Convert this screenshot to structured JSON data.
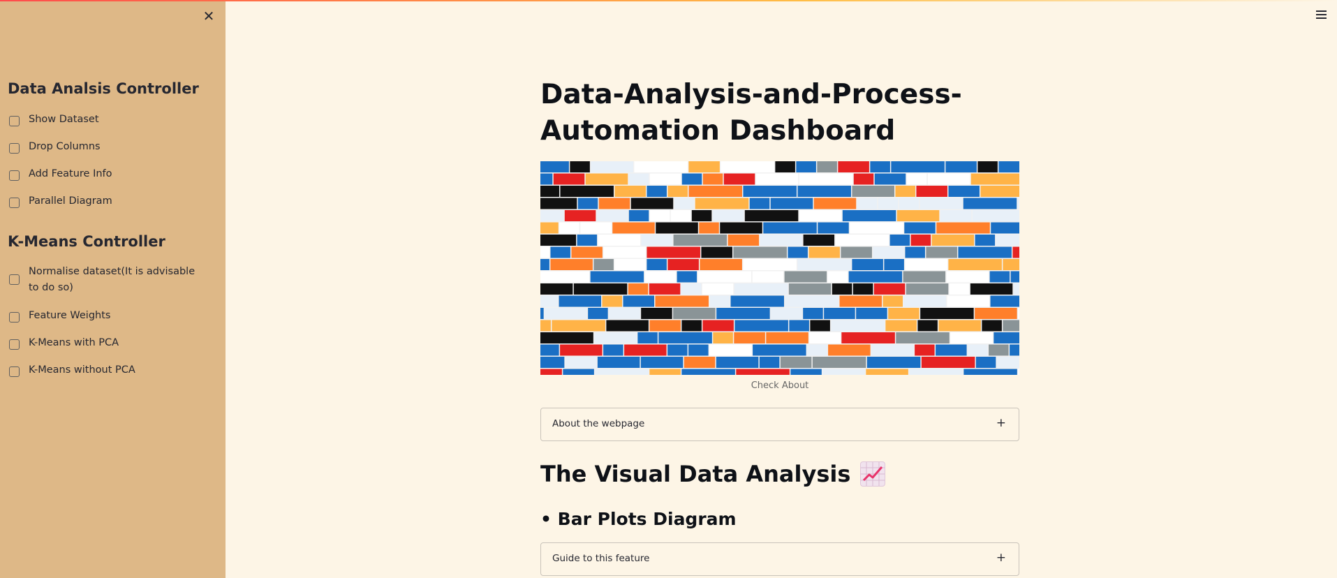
{
  "sidebar": {
    "close_icon": "close-icon",
    "sections": [
      {
        "title": "Data Analsis Controller",
        "items": [
          "Show Dataset",
          "Drop Columns",
          "Add Feature Info",
          "Parallel Diagram"
        ]
      },
      {
        "title": "K-Means Controller",
        "items": [
          "Normalise dataset(It is advisable to do so)",
          "Feature Weights",
          "K-Means with PCA",
          "K-Means without PCA"
        ]
      }
    ]
  },
  "header": {
    "menu_icon": "hamburger-menu-icon"
  },
  "main": {
    "title": "Data-Analysis-and-Process-Automation Dashboard",
    "image_caption": "Check About",
    "expanders": [
      {
        "label": "About the webpage",
        "icon": "+"
      },
      {
        "label": "Guide to this feature",
        "icon": "+"
      }
    ],
    "section_heading": "The Visual Data Analysis",
    "section_emoji": "chart-increasing-icon",
    "subheading": "• Bar Plots Diagram"
  },
  "colors": {
    "sidebar_bg": "#deb887",
    "main_bg": "#fdf5e6",
    "text": "#262730"
  }
}
